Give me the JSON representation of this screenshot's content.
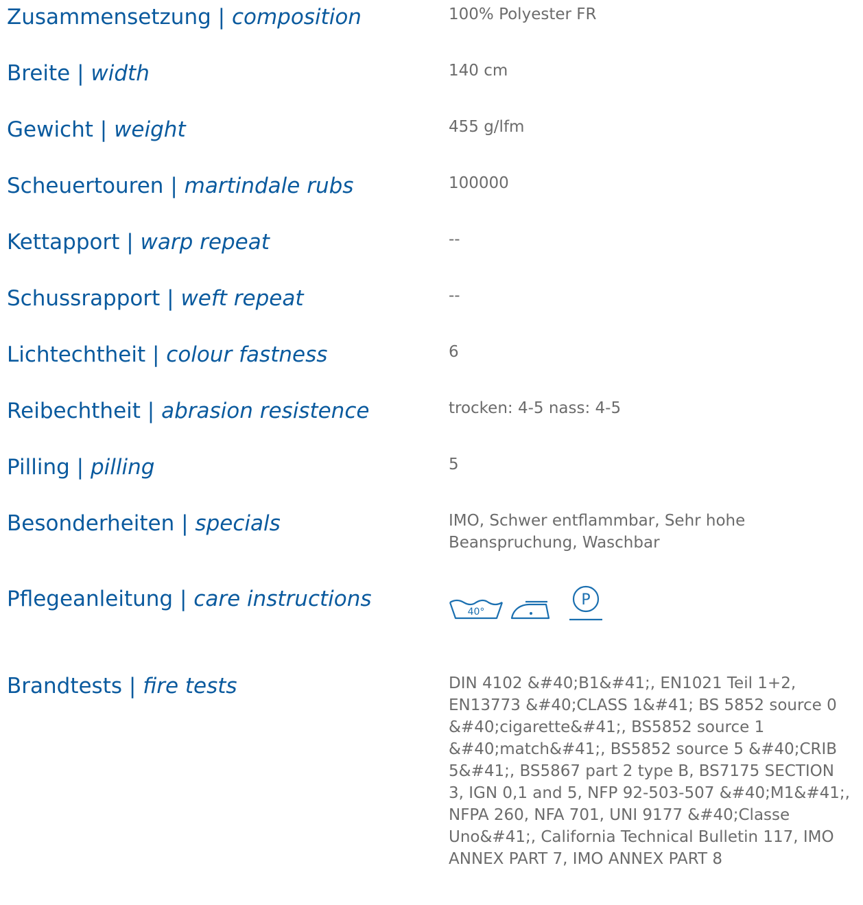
{
  "specs": [
    {
      "label_de": "Zusammensetzung",
      "label_en": "composition",
      "value": "100% Polyester FR"
    },
    {
      "label_de": "Breite",
      "label_en": "width",
      "value": "140 cm"
    },
    {
      "label_de": "Gewicht",
      "label_en": "weight",
      "value": "455 g/lfm"
    },
    {
      "label_de": "Scheuertouren",
      "label_en": "martindale rubs",
      "value": "100000"
    },
    {
      "label_de": "Kettapport",
      "label_en": "warp repeat",
      "value": "--"
    },
    {
      "label_de": "Schussrapport",
      "label_en": "weft repeat",
      "value": "--"
    },
    {
      "label_de": "Lichtechtheit",
      "label_en": "colour fastness",
      "value": "6"
    },
    {
      "label_de": "Reibechtheit",
      "label_en": "abrasion resistence",
      "value": "trocken: 4-5 nass: 4-5"
    },
    {
      "label_de": "Pilling",
      "label_en": "pilling",
      "value": "5"
    },
    {
      "label_de": "Besonderheiten",
      "label_en": "specials",
      "value": "IMO, Schwer entflammbar, Sehr hohe Beanspruchung, Waschbar"
    },
    {
      "label_de": "Pflegeanleitung",
      "label_en": "care instructions",
      "value": ""
    },
    {
      "label_de": "Brandtests",
      "label_en": "fire tests",
      "value": "DIN 4102 &#40;B1&#41;, EN1021 Teil 1+2, EN13773 &#40;CLASS 1&#41; BS 5852 source 0 &#40;cigarette&#41;, BS5852 source 1 &#40;match&#41;, BS5852 source 5 &#40;CRIB 5&#41;, BS5867 part 2 type B, BS7175 SECTION 3, IGN 0,1 and 5, NFP 92-503-507 &#40;M1&#41;, NFPA 260, NFA 701, UNI 9177 &#40;Classe Uno&#41;, California Technical Bulletin 117, IMO ANNEX PART 7, IMO ANNEX PART 8"
    }
  ],
  "separator": " | ",
  "care_icons": {
    "wash_text": "40°",
    "professional_text": "P",
    "icons": [
      "wash-40-icon",
      "iron-low-icon",
      "professional-cleaning-p-icon"
    ]
  },
  "colors": {
    "label": "#0a5a9e",
    "value": "#6b6b6b",
    "icon": "#1a6fb0"
  }
}
